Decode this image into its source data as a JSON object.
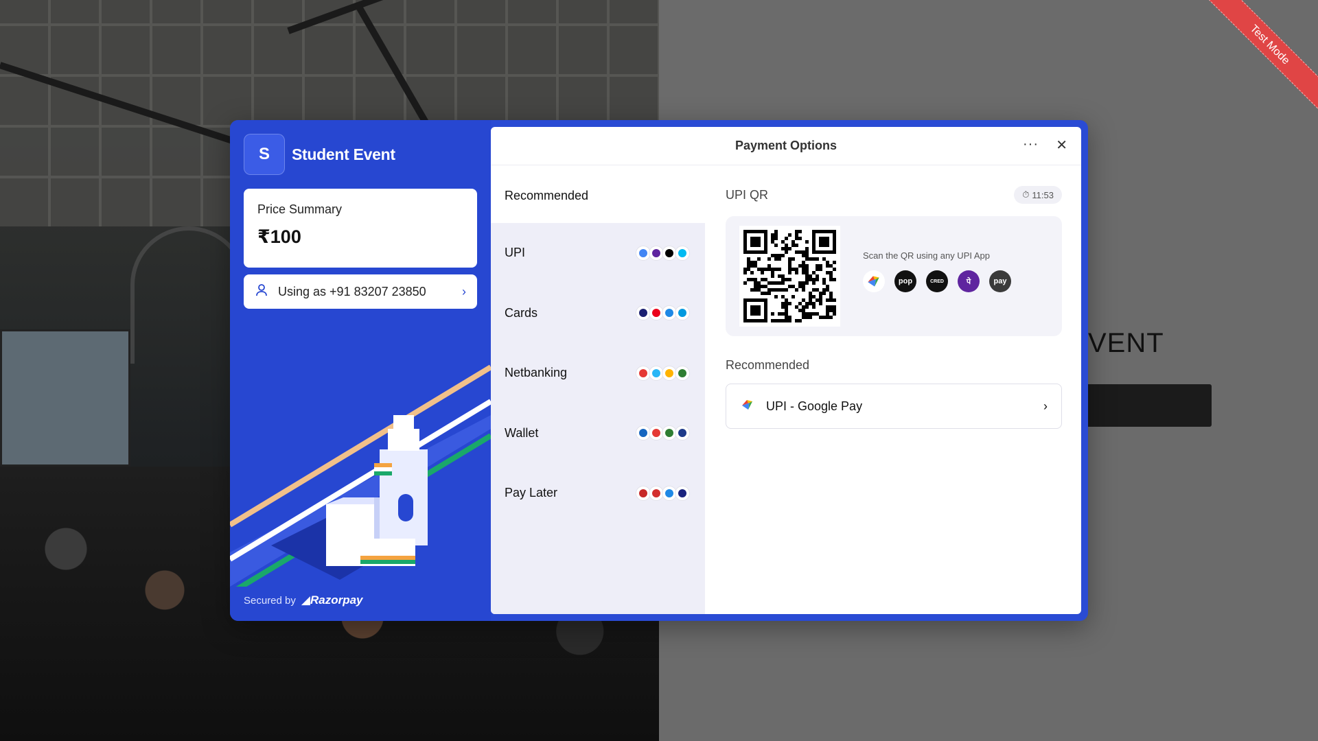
{
  "background": {
    "event_title": "VENT",
    "ribbon": "Test Mode"
  },
  "merchant": {
    "initial": "S",
    "name": "Student Event"
  },
  "price_summary": {
    "label": "Price Summary",
    "amount": "₹100"
  },
  "user": {
    "label": "Using as +91 83207 23850"
  },
  "footer": {
    "secured_by": "Secured by",
    "brand": "Razorpay"
  },
  "topbar": {
    "title": "Payment Options",
    "more": "···",
    "close": "✕"
  },
  "methods": {
    "heading": "Recommended",
    "items": [
      {
        "label": "UPI",
        "chips": [
          "#4285f4",
          "#5f259f",
          "#000000",
          "#00baf2"
        ]
      },
      {
        "label": "Cards",
        "chips": [
          "#1a1f71",
          "#eb001b",
          "#1e88e5",
          "#0099df"
        ]
      },
      {
        "label": "Netbanking",
        "chips": [
          "#e53935",
          "#29b6f6",
          "#ffb300",
          "#2e7d32"
        ]
      },
      {
        "label": "Wallet",
        "chips": [
          "#1565c0",
          "#e53935",
          "#2e7d32",
          "#1e3a8a"
        ]
      },
      {
        "label": "Pay Later",
        "chips": [
          "#c62828",
          "#d32f2f",
          "#1e88e5",
          "#1a237e"
        ]
      }
    ]
  },
  "upi_qr": {
    "title": "UPI QR",
    "timer": "11:53",
    "hint": "Scan the QR using any UPI App",
    "apps": [
      {
        "name": "gpay-icon",
        "color": "#ffffff",
        "text": ""
      },
      {
        "name": "pop-icon",
        "color": "#111111",
        "text": "pop"
      },
      {
        "name": "cred-icon",
        "color": "#111111",
        "text": "CRED"
      },
      {
        "name": "phonepe-icon",
        "color": "#5f259f",
        "text": "पे"
      },
      {
        "name": "amazonpay-icon",
        "color": "#3a3a3a",
        "text": "pay"
      }
    ]
  },
  "recommended": {
    "label": "Recommended",
    "item": "UPI - Google Pay"
  },
  "colors": {
    "brand_blue": "#2747d1",
    "methods_bg": "#eeeef8",
    "ribbon_red": "#e04545"
  }
}
